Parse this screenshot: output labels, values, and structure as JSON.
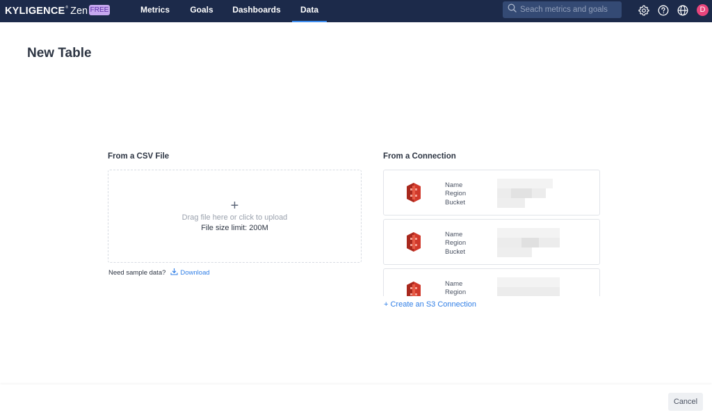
{
  "header": {
    "brand_name": "KYLIGENCE",
    "brand_tm": "®",
    "brand_sub": "Zen",
    "plan_badge": "FREE",
    "nav": [
      {
        "label": "Metrics"
      },
      {
        "label": "Goals"
      },
      {
        "label": "Dashboards"
      },
      {
        "label": "Data",
        "active": true
      }
    ],
    "search": {
      "placeholder": "Seach metrics and goals",
      "icon": "search-icon"
    },
    "icons": [
      "gear-icon",
      "help-icon",
      "globe-icon"
    ],
    "avatar_initial": "D",
    "accent_color": "#3d8ef0",
    "background_color": "#1c2a4a"
  },
  "page": {
    "title": "New Table"
  },
  "csv_section": {
    "label": "From a CSV File",
    "upload_hint": "Drag file here or click to upload",
    "size_limit": "File size limit: 200M",
    "plus_icon": "plus-icon",
    "sample_text": "Need sample data?",
    "download_label": "Download",
    "download_icon": "download-icon"
  },
  "connection_section": {
    "label": "From a Connection",
    "connections": [
      {
        "logo": "s3-bucket-icon",
        "fields": [
          "Name",
          "Region",
          "Bucket"
        ]
      },
      {
        "logo": "s3-bucket-icon",
        "fields": [
          "Name",
          "Region",
          "Bucket"
        ]
      },
      {
        "logo": "s3-bucket-icon",
        "fields": [
          "Name",
          "Region"
        ]
      }
    ],
    "create_label": "+ Create an S3 Connection",
    "logo_color": "#d0392b"
  },
  "footer": {
    "cancel_label": "Cancel"
  }
}
